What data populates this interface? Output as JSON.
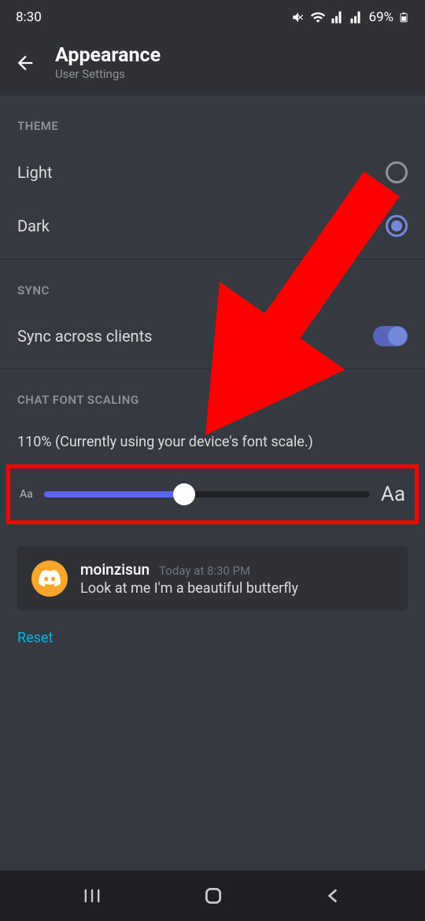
{
  "statusBar": {
    "time": "8:30",
    "battery": "69%"
  },
  "header": {
    "title": "Appearance",
    "subtitle": "User Settings"
  },
  "sections": {
    "theme": {
      "header": "THEME",
      "options": {
        "light": "Light",
        "dark": "Dark"
      }
    },
    "sync": {
      "header": "SYNC",
      "label": "Sync across clients"
    },
    "fontScaling": {
      "header": "CHAT FONT SCALING",
      "scaleText": "110% (Currently using your device's font scale.)",
      "aaSmall": "Aa",
      "aaLarge": "Aa"
    }
  },
  "preview": {
    "username": "moinzisun",
    "timestamp": "Today at 8:30 PM",
    "message": "Look at me I'm a beautiful butterfly"
  },
  "reset": "Reset",
  "colors": {
    "accent": "#7289da",
    "link": "#00b0f4",
    "annotation": "#ff0000"
  }
}
